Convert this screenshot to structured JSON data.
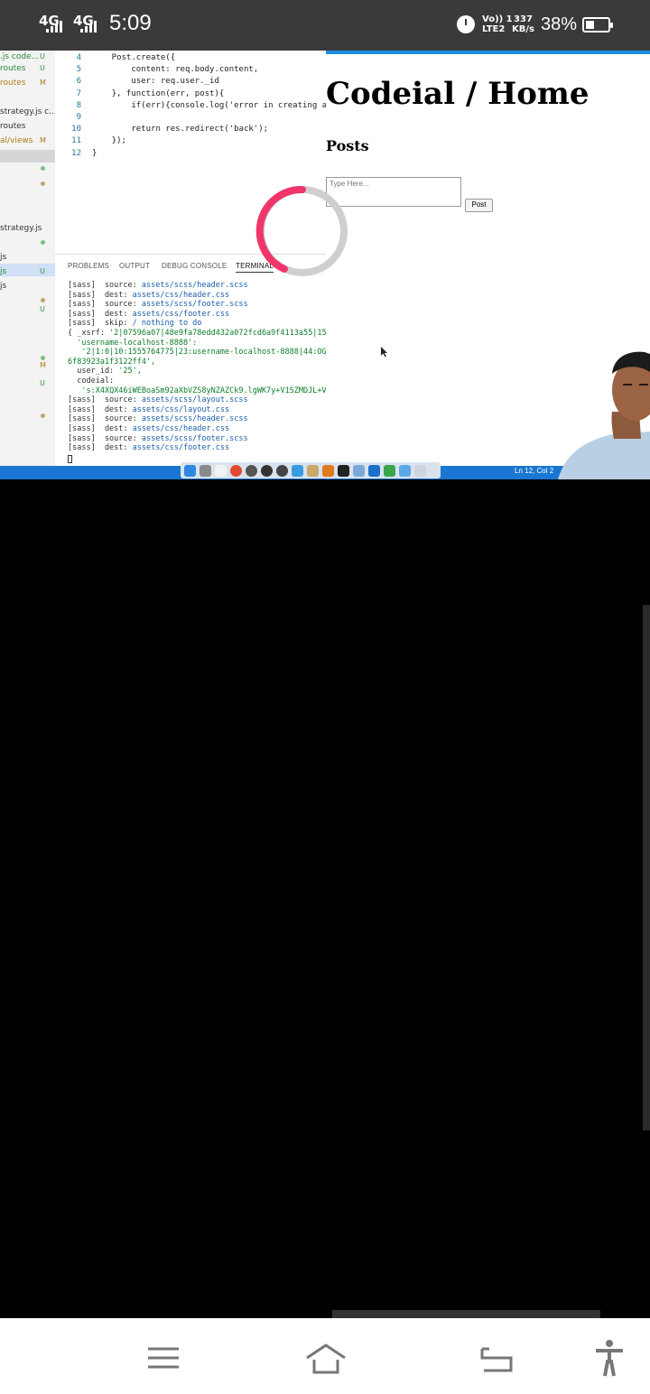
{
  "status_bar": {
    "network_1": "4G",
    "network_2": "4G",
    "time": "5:09",
    "volte": [
      "Vo)) 1",
      "LTE2"
    ],
    "data_speed": [
      "337",
      "KB/s"
    ],
    "battery_percent": "38%",
    "battery_level": 0.38,
    "icons": [
      "signal-icon",
      "alarm-icon",
      "battery-icon"
    ]
  },
  "explorer": {
    "items": [
      {
        "name": ".js code...",
        "status": "U",
        "status_color": "#2a9a3a"
      },
      {
        "name": "routes",
        "status": "U",
        "status_color": "#2a9a3a"
      },
      {
        "name": "routes",
        "status": "M",
        "status_color": "#b07a1a"
      },
      {
        "name": "strategy.js c...",
        "status": "",
        "status_color": ""
      },
      {
        "name": "routes",
        "status": "",
        "status_color": ""
      },
      {
        "name": "al/views",
        "status": "M",
        "status_color": "#b07a1a"
      },
      {
        "name": "strategy.js",
        "status": "",
        "status_color": ""
      },
      {
        "name": "js",
        "status": "",
        "status_color": ""
      },
      {
        "name": "js",
        "status": "U",
        "status_color": "#2a9a3a"
      },
      {
        "name": "js",
        "status": "",
        "status_color": ""
      },
      {
        "name": "",
        "status": "U",
        "status_color": "#2a9a3a"
      },
      {
        "name": "",
        "status": "M",
        "status_color": "#b07a1a"
      },
      {
        "name": "",
        "status": "U",
        "status_color": "#2a9a3a"
      }
    ]
  },
  "editor": {
    "lines": [
      {
        "num": "4",
        "code": "    Post.create({"
      },
      {
        "num": "5",
        "code": "        content: req.body.content,"
      },
      {
        "num": "6",
        "code": "        user: req.user._id"
      },
      {
        "num": "7",
        "code": "    }, function(err, post){"
      },
      {
        "num": "8",
        "code": "        if(err){console.log('error in creating a"
      },
      {
        "num": "9",
        "code": ""
      },
      {
        "num": "10",
        "code": "        return res.redirect('back');"
      },
      {
        "num": "11",
        "code": "    });"
      },
      {
        "num": "12",
        "code": "}"
      }
    ]
  },
  "panel": {
    "tabs": [
      "PROBLEMS",
      "OUTPUT",
      "DEBUG CONSOLE",
      "TERMINAL"
    ],
    "active_tab": "TERMINAL"
  },
  "terminal": {
    "lines": [
      {
        "pre": "[sass]  source: ",
        "hl": "assets/scss/header.scss",
        "cls": "path"
      },
      {
        "pre": "[sass]  dest: ",
        "hl": "assets/css/header.css",
        "cls": "path"
      },
      {
        "pre": "[sass]  source: ",
        "hl": "assets/scss/footer.scss",
        "cls": "path"
      },
      {
        "pre": "[sass]  dest: ",
        "hl": "assets/css/footer.css",
        "cls": "path"
      },
      {
        "pre": "[sass]  skip: ",
        "hl": "/ nothing to do",
        "cls": "path"
      },
      {
        "pre": "{ _xsrf: ",
        "hl": "'2|07596a07|48e9fa78edd432a072fcd6a9f4113a55|15",
        "cls": "grn"
      },
      {
        "pre": "  ",
        "hl": "'username-localhost-8888':",
        "cls": "grn"
      },
      {
        "pre": "   ",
        "hl": "'2|1:0|10:1555764775|23:username-localhost-8888|44:OG",
        "cls": "grn"
      },
      {
        "pre": "",
        "hl": "6f83923a1f3122ff4',",
        "cls": "grn"
      },
      {
        "pre": "  user_id: ",
        "hl": "'25',",
        "cls": "grn"
      },
      {
        "pre": "  codeial:",
        "hl": "",
        "cls": "grn"
      },
      {
        "pre": "   ",
        "hl": "'s:X4XQX46iWEBoaSm92aXbVZS8yNZAZCk9.lgWK7y+V1SZMDJL+V",
        "cls": "grn"
      },
      {
        "pre": "[sass]  source: ",
        "hl": "assets/scss/layout.scss",
        "cls": "path"
      },
      {
        "pre": "[sass]  dest: ",
        "hl": "assets/css/layout.css",
        "cls": "path"
      },
      {
        "pre": "[sass]  source: ",
        "hl": "assets/scss/header.scss",
        "cls": "path"
      },
      {
        "pre": "[sass]  dest: ",
        "hl": "assets/css/header.css",
        "cls": "path"
      },
      {
        "pre": "[sass]  source: ",
        "hl": "assets/scss/footer.scss",
        "cls": "path"
      },
      {
        "pre": "[sass]  dest: ",
        "hl": "assets/css/footer.css",
        "cls": "path"
      }
    ]
  },
  "browser": {
    "title": "Codeial / Home",
    "subtitle": "Posts",
    "textarea_placeholder": "Type Here...",
    "post_button": "Post"
  },
  "statusline": {
    "position": "Ln 12, Col 2"
  },
  "nav_bar": {
    "icons": [
      "menu-icon",
      "home-icon",
      "back-icon",
      "accessibility-icon"
    ]
  }
}
